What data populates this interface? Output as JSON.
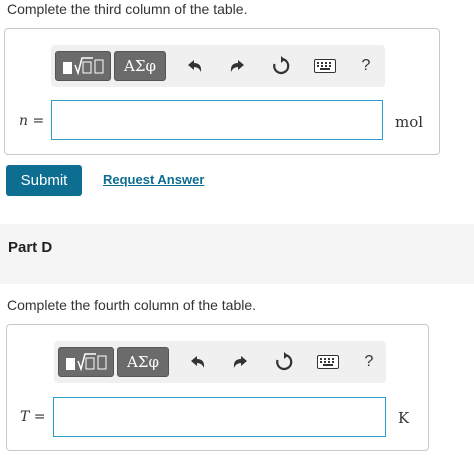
{
  "part_c": {
    "instruction": "Complete the third column of the table.",
    "symbol_button_label": "ΑΣφ",
    "help_label": "?",
    "variable": "n",
    "equals": "=",
    "input_value": "",
    "unit": "mol"
  },
  "actions": {
    "submit_label": "Submit",
    "request_answer_label": "Request Answer"
  },
  "part_d": {
    "title": "Part D",
    "instruction": "Complete the fourth column of the table.",
    "symbol_button_label": "ΑΣφ",
    "help_label": "?",
    "variable": "T",
    "equals": "=",
    "input_value": "",
    "unit": "K"
  },
  "toolbar_icons": [
    "templates-icon",
    "greek-symbols-icon",
    "undo-icon",
    "redo-icon",
    "reset-icon",
    "keyboard-icon",
    "help-icon"
  ],
  "colors": {
    "accent": "#0d6e92",
    "input_border": "#2aa0c8",
    "toolbar_button": "#6b6b6b",
    "section_band": "#f5f5f5"
  }
}
